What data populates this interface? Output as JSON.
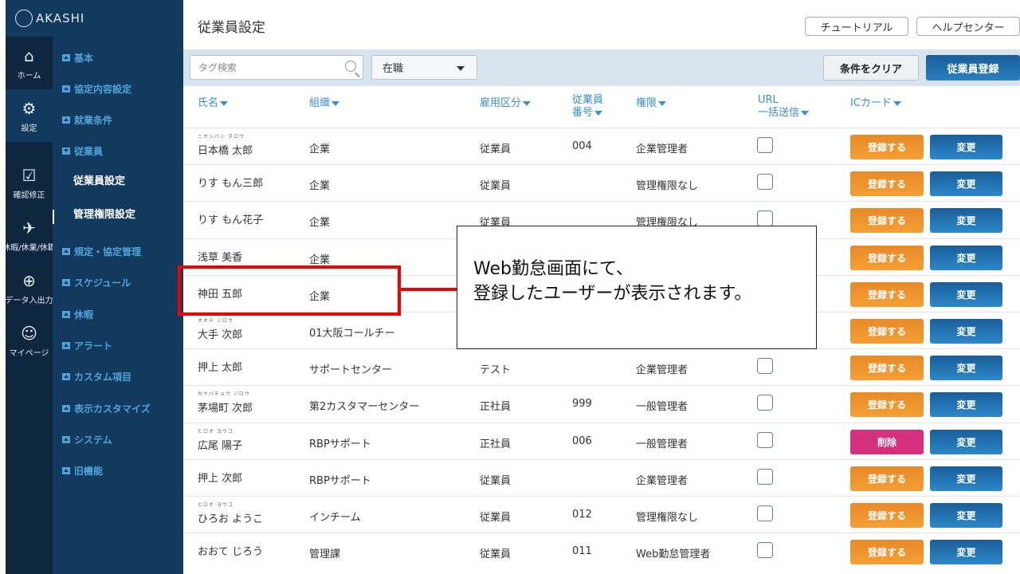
{
  "app": {
    "logo": "AKASHI"
  },
  "rail": [
    {
      "label": "ホーム",
      "icon": "home-icon"
    },
    {
      "label": "設定",
      "icon": "gear-icon"
    },
    {
      "label": "確認修正",
      "icon": "clipboard-check-icon"
    },
    {
      "label": "休暇/休業/休職",
      "icon": "dove-icon"
    },
    {
      "label": "データ入出力",
      "icon": "download-icon"
    },
    {
      "label": "マイページ",
      "icon": "user-icon"
    }
  ],
  "menu": {
    "items": [
      "基本",
      "協定内容設定",
      "就業条件",
      "従業員"
    ],
    "sub": [
      "従業員設定",
      "管理権限設定"
    ],
    "items2": [
      "規定・協定管理",
      "スケジュール",
      "休暇",
      "アラート",
      "カスタム項目",
      "表示カスタマイズ",
      "システム",
      "旧機能"
    ]
  },
  "header": {
    "title": "従業員設定",
    "tutorial": "チュートリアル",
    "help": "ヘルプセンター"
  },
  "filter": {
    "search_placeholder": "タグ検索",
    "status": "在職",
    "clear": "条件をクリア",
    "register": "従業員登録"
  },
  "columns": {
    "name": "氏名",
    "org": "組織",
    "type": "雇用区分",
    "num1": "従業員",
    "num2": "番号",
    "perm": "権限",
    "url1": "URL",
    "url2": "一括送信",
    "ic": "ICカード"
  },
  "rows": [
    {
      "ruby": "ニホンバシ タロウ",
      "name": "日本橋 太郎",
      "org": "企業",
      "type": "従業員",
      "num": "004",
      "perm": "企業管理者",
      "action": "登録する",
      "change": "変更"
    },
    {
      "ruby": "",
      "name": "りす もん三郎",
      "org": "企業",
      "type": "従業員",
      "num": "",
      "perm": "管理権限なし",
      "action": "登録する",
      "change": "変更"
    },
    {
      "ruby": "",
      "name": "りす もん花子",
      "org": "企業",
      "type": "従業員",
      "num": "",
      "perm": "管理権限なし",
      "action": "登録する",
      "change": "変更"
    },
    {
      "ruby": "",
      "name": "浅草 美香",
      "org": "企業",
      "type": "",
      "num": "",
      "perm": "",
      "action": "登録する",
      "change": "変更"
    },
    {
      "ruby": "",
      "name": "神田 五郎",
      "org": "企業",
      "type": "",
      "num": "",
      "perm": "",
      "action": "登録する",
      "change": "変更"
    },
    {
      "ruby": "オオテ ジロウ",
      "name": "大手 次郎",
      "org": "01大阪コールチー",
      "type": "",
      "num": "",
      "perm": "",
      "action": "登録する",
      "change": "変更"
    },
    {
      "ruby": "",
      "name": "押上 太郎",
      "org": "サポートセンター",
      "type": "テスト",
      "num": "",
      "perm": "企業管理者",
      "action": "登録する",
      "change": "変更"
    },
    {
      "ruby": "カヤバチョウ ジロウ",
      "name": "茅場町 次郎",
      "org": "第2カスタマーセンター",
      "type": "正社員",
      "num": "999",
      "perm": "一般管理者",
      "action": "登録する",
      "change": "変更"
    },
    {
      "ruby": "ヒロオ ヨウコ",
      "name": "広尾 陽子",
      "org": "RBPサポート",
      "type": "正社員",
      "num": "006",
      "perm": "一般管理者",
      "action": "削除",
      "change": "変更"
    },
    {
      "ruby": "",
      "name": "押上 次郎",
      "org": "RBPサポート",
      "type": "従業員",
      "num": "",
      "perm": "企業管理者",
      "action": "登録する",
      "change": "変更"
    },
    {
      "ruby": "ヒロオ ヨウコ",
      "name": "ひろお ようこ",
      "org": "インチーム",
      "type": "従業員",
      "num": "012",
      "perm": "管理権限なし",
      "action": "登録する",
      "change": "変更"
    },
    {
      "ruby": "",
      "name": "おおて じろう",
      "org": "管理課",
      "type": "従業員",
      "num": "011",
      "perm": "Web勤怠管理者",
      "action": "登録する",
      "change": "変更"
    }
  ],
  "callout": {
    "line1": "Web勤怠画面にて、",
    "line2": "登録したユーザーが表示されます。"
  }
}
